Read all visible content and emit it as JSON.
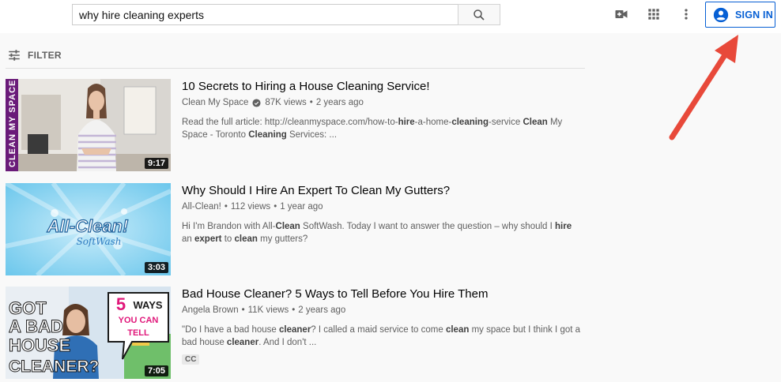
{
  "search": {
    "query": "why hire cleaning experts"
  },
  "header": {
    "sign_in_label": "SIGN IN"
  },
  "filter": {
    "label": "FILTER"
  },
  "results": [
    {
      "title": "10 Secrets to Hiring a House Cleaning Service!",
      "channel": "Clean My Space",
      "verified": true,
      "views": "87K views",
      "age": "2 years ago",
      "duration": "9:17",
      "thumb_text": "CLEAN MY SPACE",
      "desc": [
        {
          "t": "Read the full article: http://cleanmyspace.com/how-to-",
          "b": false
        },
        {
          "t": "hire",
          "b": true
        },
        {
          "t": "-a-home-",
          "b": false
        },
        {
          "t": "cleaning",
          "b": true
        },
        {
          "t": "-service ",
          "b": false
        },
        {
          "t": "Clean",
          "b": true
        },
        {
          "t": " My Space - Toronto ",
          "b": false
        },
        {
          "t": "Cleaning",
          "b": true
        },
        {
          "t": " Services: ...",
          "b": false
        }
      ]
    },
    {
      "title": "Why Should I Hire An Expert To Clean My Gutters?",
      "channel": "All-Clean!",
      "verified": false,
      "views": "112 views",
      "age": "1 year ago",
      "duration": "3:03",
      "thumb_text_1": "All-Clean!",
      "thumb_text_2": "SoftWash",
      "desc": [
        {
          "t": "Hi I'm Brandon with All-",
          "b": false
        },
        {
          "t": "Clean",
          "b": true
        },
        {
          "t": " SoftWash. Today I want to answer the question – why should I ",
          "b": false
        },
        {
          "t": "hire",
          "b": true
        },
        {
          "t": " an ",
          "b": false
        },
        {
          "t": "expert",
          "b": true
        },
        {
          "t": " to ",
          "b": false
        },
        {
          "t": "clean",
          "b": true
        },
        {
          "t": " my gutters?",
          "b": false
        }
      ]
    },
    {
      "title": "Bad House Cleaner? 5 Ways to Tell Before You Hire Them",
      "channel": "Angela Brown",
      "verified": false,
      "views": "11K views",
      "age": "2 years ago",
      "duration": "7:05",
      "badge": "CC",
      "thumb_lines": [
        "GOT",
        "A BAD",
        "HOUSE",
        "CLEANER?"
      ],
      "thumb_bubble": [
        "5",
        "WAYS",
        "YOU CAN",
        "TELL"
      ],
      "desc": [
        {
          "t": "\"Do I have a bad house ",
          "b": false
        },
        {
          "t": "cleaner",
          "b": true
        },
        {
          "t": "? I called a maid service to come ",
          "b": false
        },
        {
          "t": "clean",
          "b": true
        },
        {
          "t": " my space but I think I got a bad house ",
          "b": false
        },
        {
          "t": "cleaner",
          "b": true
        },
        {
          "t": ". And I don't ...",
          "b": false
        }
      ]
    }
  ],
  "colors": {
    "accent": "#065fd4",
    "annotation_arrow": "#e8493a"
  },
  "icons": [
    "search-icon",
    "video-camera-icon",
    "apps-grid-icon",
    "more-vert-icon",
    "account-icon",
    "filter-icon",
    "verified-icon"
  ]
}
